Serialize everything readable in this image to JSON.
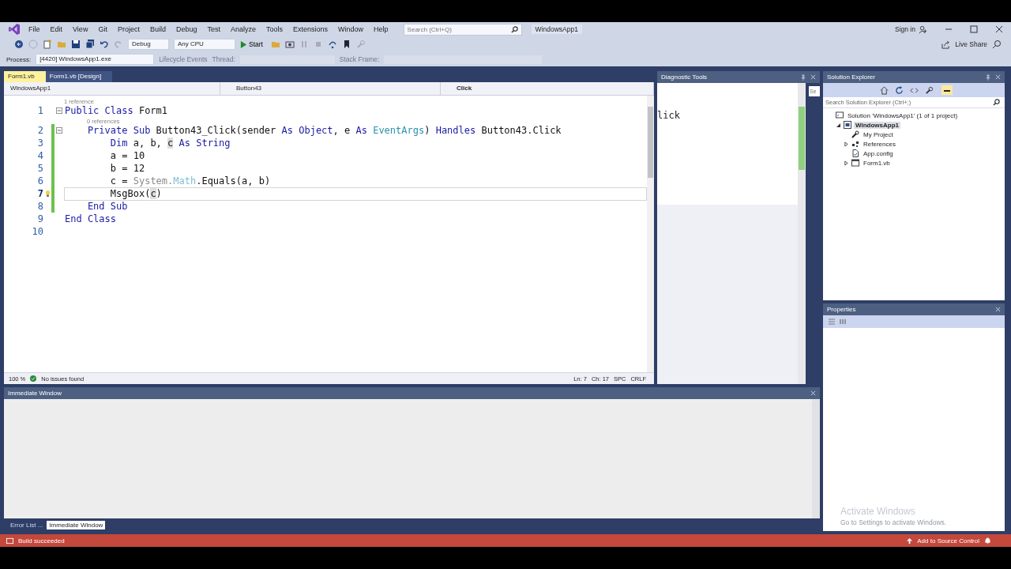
{
  "title_bar": {
    "menus": [
      "File",
      "Edit",
      "View",
      "Git",
      "Project",
      "Build",
      "Debug",
      "Test",
      "Analyze",
      "Tools",
      "Extensions",
      "Window",
      "Help"
    ],
    "search": {
      "placeholder": "Search (Ctrl+Q)"
    },
    "solution_name": "WindowsApp1",
    "sign_in": "Sign in"
  },
  "toolbar": {
    "configuration": "Debug",
    "platform": "Any CPU",
    "start": "Start",
    "live_share": "Live Share"
  },
  "debug_location": {
    "process_label": "Process:",
    "process": "[4420] WindowsApp1.exe",
    "lifecycle": "Lifecycle Events",
    "thread_label": "Thread:",
    "stack_frame_label": "Stack Frame:"
  },
  "document_tabs": [
    {
      "label": "Form1.vb",
      "selected": true
    },
    {
      "label": "Form1.vb [Design]",
      "selected": false
    }
  ],
  "navigation_bar": {
    "project": "WindowsApp1",
    "object": "Button43",
    "member": "Click"
  },
  "editor": {
    "lines": [
      {
        "kind": "codelens",
        "text": "1 reference"
      },
      {
        "kind": "code",
        "number": "1",
        "fold": true,
        "modified": false,
        "current": false,
        "lightbulb": false,
        "segments": [
          {
            "kind": "keyword",
            "text": "Public Class "
          },
          {
            "kind": "plain",
            "text": "Form1"
          }
        ]
      },
      {
        "kind": "codelens",
        "text": "0 references"
      },
      {
        "kind": "code",
        "number": "2",
        "fold": true,
        "modified": true,
        "current": false,
        "lightbulb": false,
        "segments": [
          {
            "kind": "keyword",
            "text": "    Private Sub "
          },
          {
            "kind": "plain",
            "text": "Button43_Click(sender "
          },
          {
            "kind": "keyword",
            "text": "As Object"
          },
          {
            "kind": "plain",
            "text": ", e "
          },
          {
            "kind": "keyword",
            "text": "As "
          },
          {
            "kind": "type",
            "text": "EventArgs"
          },
          {
            "kind": "plain",
            "text": ") "
          },
          {
            "kind": "keyword",
            "text": "Handles "
          },
          {
            "kind": "plain",
            "text": "Button43.Click"
          }
        ]
      },
      {
        "kind": "code",
        "number": "3",
        "fold": false,
        "modified": true,
        "current": false,
        "lightbulb": false,
        "segments": [
          {
            "kind": "keyword",
            "text": "        Dim "
          },
          {
            "kind": "plain",
            "text": "a, b, "
          },
          {
            "kind": "highlight",
            "text": "c"
          },
          {
            "kind": "keyword",
            "text": " As String"
          }
        ]
      },
      {
        "kind": "code",
        "number": "4",
        "fold": false,
        "modified": true,
        "current": false,
        "lightbulb": false,
        "segments": [
          {
            "kind": "plain",
            "text": "        a = 10"
          }
        ]
      },
      {
        "kind": "code",
        "number": "5",
        "fold": false,
        "modified": true,
        "current": false,
        "lightbulb": false,
        "segments": [
          {
            "kind": "plain",
            "text": "        b = 12"
          }
        ]
      },
      {
        "kind": "code",
        "number": "6",
        "fold": false,
        "modified": true,
        "current": false,
        "lightbulb": false,
        "segments": [
          {
            "kind": "plain",
            "text": "        c = "
          },
          {
            "kind": "faded",
            "text": "System."
          },
          {
            "kind": "faded_type",
            "text": "Math"
          },
          {
            "kind": "plain",
            "text": ".Equals(a, b)"
          }
        ]
      },
      {
        "kind": "code",
        "number": "7",
        "fold": false,
        "modified": true,
        "current": true,
        "lightbulb": true,
        "segments": [
          {
            "kind": "plain",
            "text": "        MsgBox("
          },
          {
            "kind": "highlight",
            "text": "c"
          },
          {
            "kind": "plain",
            "text": ")"
          }
        ]
      },
      {
        "kind": "code",
        "number": "8",
        "fold": false,
        "modified": true,
        "current": false,
        "lightbulb": false,
        "segments": [
          {
            "kind": "keyword",
            "text": "    End Sub"
          }
        ]
      },
      {
        "kind": "code",
        "number": "9",
        "fold": false,
        "modified": false,
        "current": false,
        "lightbulb": false,
        "segments": [
          {
            "kind": "keyword",
            "text": "End Class"
          }
        ]
      },
      {
        "kind": "code",
        "number": "10",
        "fold": false,
        "modified": false,
        "current": false,
        "lightbulb": false
      }
    ],
    "zoom": "100 %",
    "issues": "No issues found",
    "line": "Ln: 7",
    "column": "Ch: 17",
    "whitespace": "SPC",
    "line_ending": "CRLF"
  },
  "diagnostic_tools": {
    "title": "Diagnostic Tools",
    "overlapped_text": "lick",
    "search_stub": "Se"
  },
  "solution_explorer": {
    "title": "Solution Explorer",
    "search": {
      "placeholder": "Search Solution Explorer (Ctrl+;)"
    },
    "tree": [
      {
        "kind": "solution",
        "label": "Solution 'WindowsApp1' (1 of 1 project)",
        "selected": false,
        "children": [
          {
            "kind": "project",
            "label": "WindowsApp1",
            "selected": true,
            "expanded": true,
            "children": [
              {
                "kind": "settings",
                "label": "My Project",
                "selected": false
              },
              {
                "kind": "references",
                "label": "References",
                "selected": false,
                "expanded": false
              },
              {
                "kind": "config",
                "label": "App.config",
                "selected": false
              },
              {
                "kind": "form",
                "label": "Form1.vb",
                "selected": false,
                "expanded": false
              }
            ]
          }
        ]
      }
    ]
  },
  "properties": {
    "title": "Properties"
  },
  "immediate_window": {
    "title": "Immediate Window"
  },
  "tool_tabs": [
    {
      "label": "Error List ...",
      "selected": false
    },
    {
      "label": "Immediate Window",
      "selected": true
    }
  ],
  "activation_notice": {
    "title": "Activate Windows",
    "subtitle": "Go to Settings to activate Windows."
  },
  "status_bar": {
    "message": "Build succeeded",
    "source_control": "Add to Source Control"
  }
}
